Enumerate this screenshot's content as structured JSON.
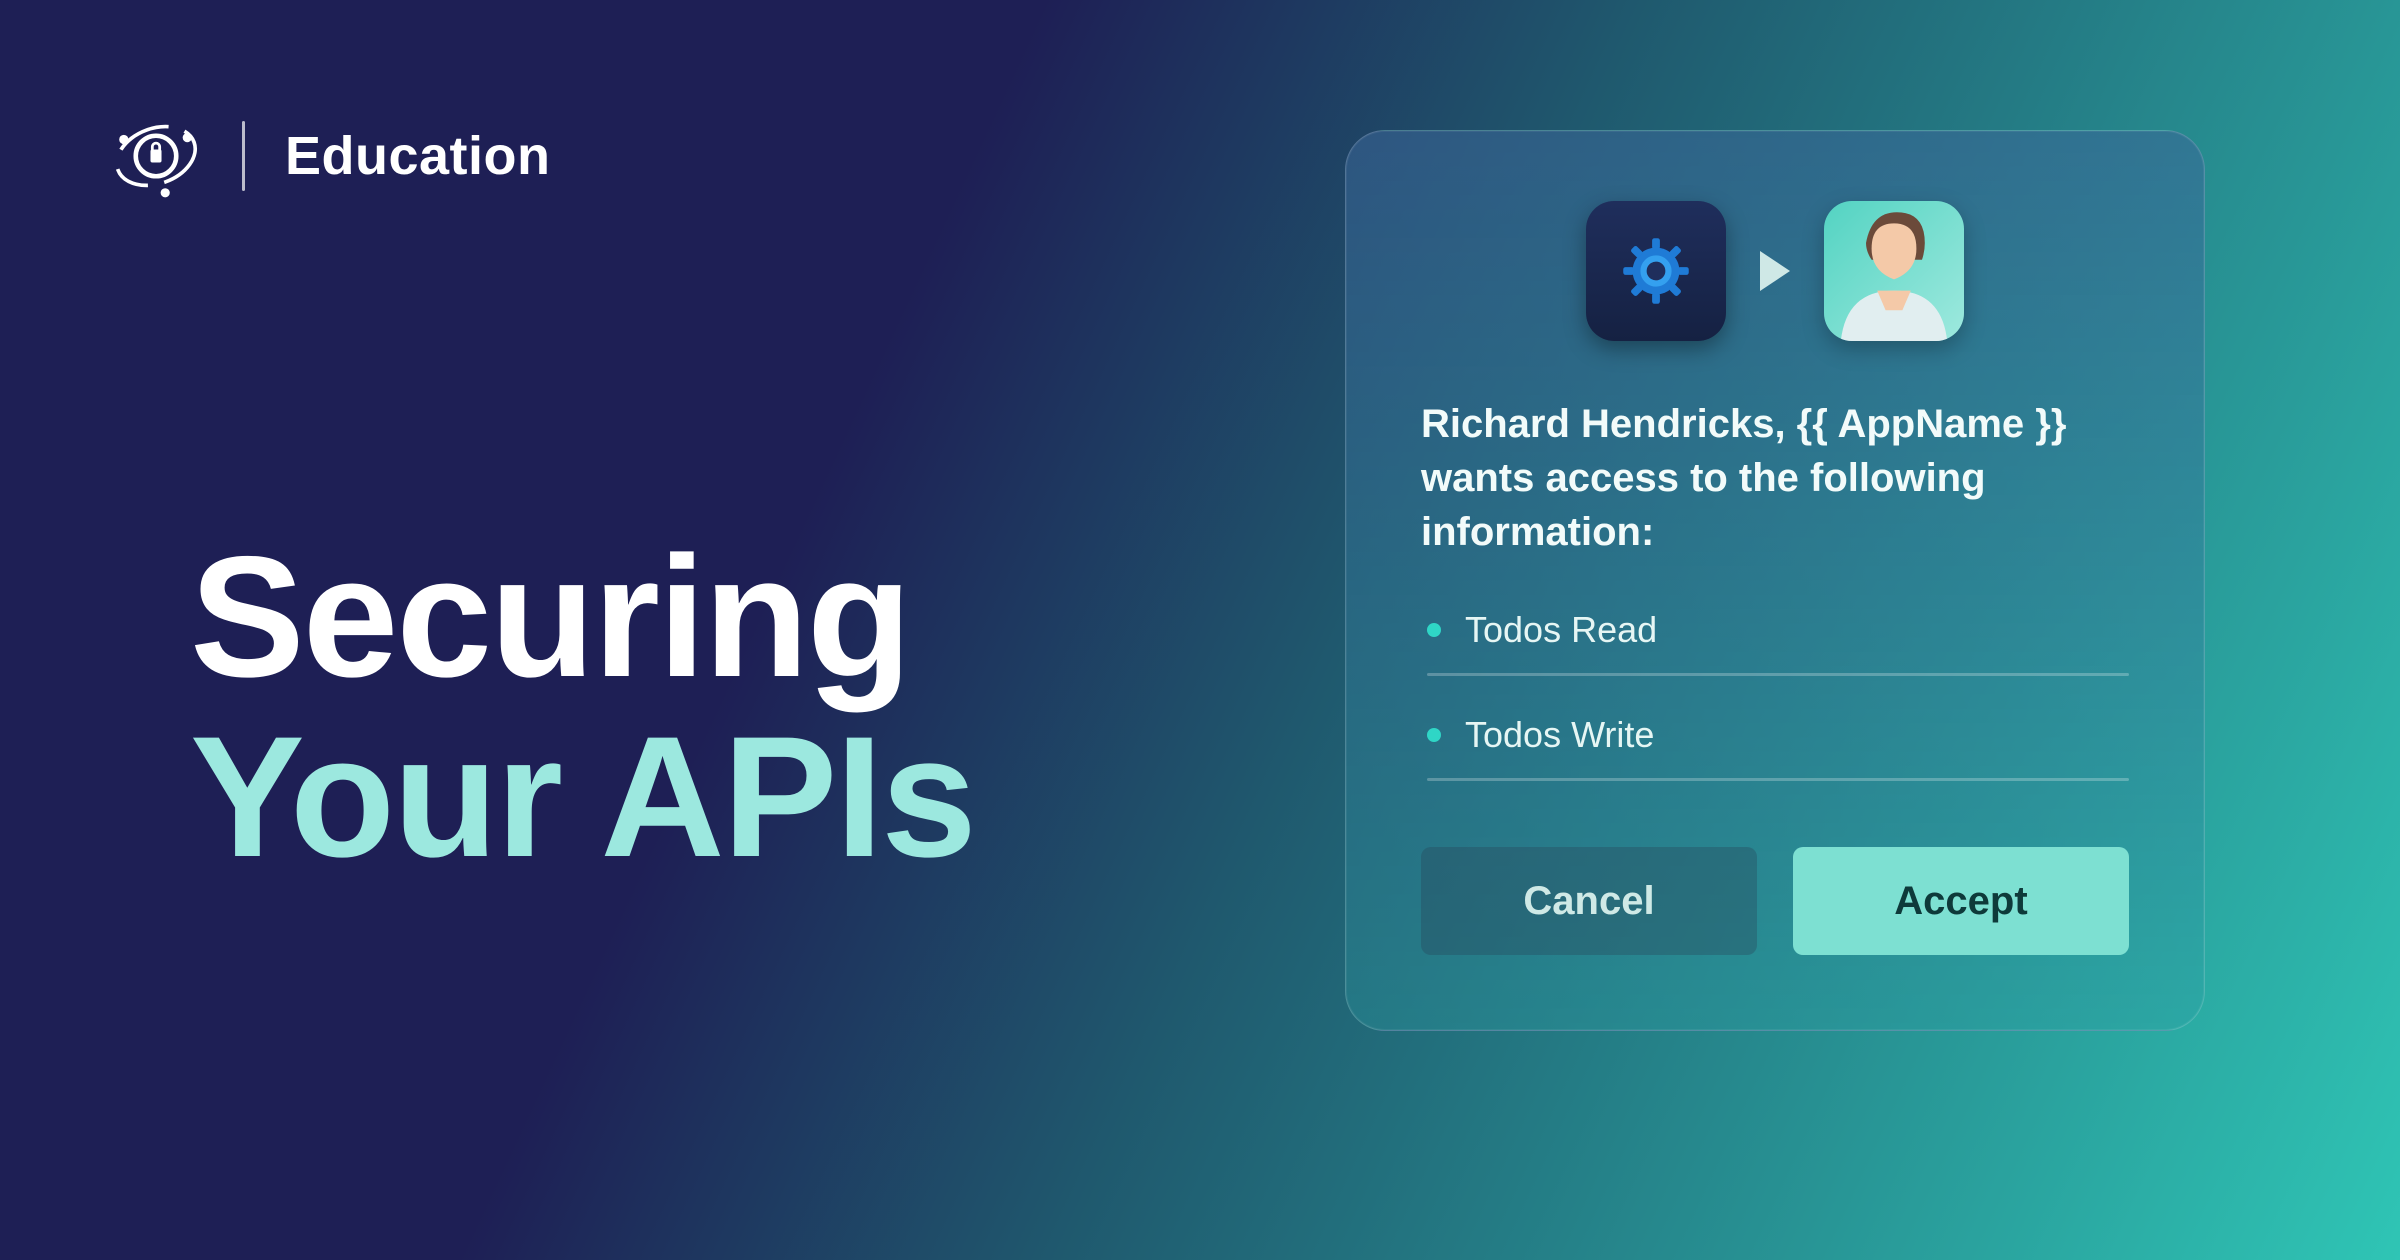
{
  "header": {
    "brand": "Education"
  },
  "hero": {
    "line1": "Securing",
    "line2": "Your APIs"
  },
  "consent": {
    "message": "Richard Hendricks, {{ AppName }} wants access to the following information:",
    "permissions": [
      "Todos Read",
      "Todos Write"
    ],
    "cancel_label": "Cancel",
    "accept_label": "Accept"
  }
}
